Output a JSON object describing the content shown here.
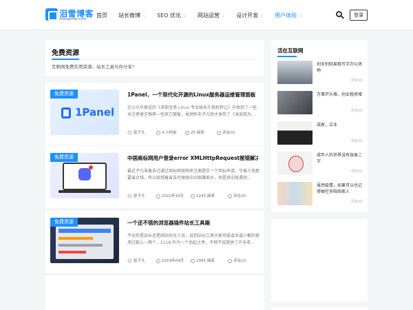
{
  "header": {
    "logo_text": "泪雪博客",
    "logo_sub": "zhangzifan.com",
    "nav": [
      {
        "label": "首页",
        "has_caret": false,
        "active": false
      },
      {
        "label": "站长微博",
        "has_caret": true,
        "active": false
      },
      {
        "label": "SEO 优化",
        "has_caret": true,
        "active": false
      },
      {
        "label": "网站运营",
        "has_caret": true,
        "active": false
      },
      {
        "label": "设计开发",
        "has_caret": true,
        "active": false
      },
      {
        "label": "用户体验",
        "has_caret": true,
        "active": true
      }
    ],
    "search_icon": "search-icon",
    "login_label": "登录"
  },
  "hero": {
    "title": "免费资源",
    "desc": "互联网免费实用资源，站长工具与你分享！"
  },
  "posts": [
    {
      "badge": "免费资源",
      "title": "1Panel，一个现代化开源的Linux服务器运维管理面板",
      "excerpt": "在公众号推送的《求购宝塔 Linux 专业版永久授权转让》中收到了一些关注者留言推荐一些其它面板，虽然昨天子凡我才发布了《浅谈我为...",
      "author": "张子凡",
      "time": "4 小时前",
      "views": "25 阅读",
      "comments": "评论(0)",
      "thumb_text": "1Panel"
    },
    {
      "badge": "免费资源",
      "title": "中国商标网用户登录error XMLHttpRequest报错解决...",
      "excerpt": "最近子凡准备自己通过商标网官网来注册提交一下商标申请，毕竟人壳那要省点钱，所以就想着省去代理商中间商赚差价，但是其中就遇到...",
      "author": "张子凡",
      "time": "2022年10月",
      "views": "1243 阅读",
      "comments": "评论(0)"
    },
    {
      "badge": "免费资源",
      "title": "一个还不错的浏览器插件站长工具箱",
      "excerpt": "不论你是站长还是网站优化人员，说到站长工具大家可能或多或少都的使用过那么一两个，5118 作为一个后起之秀，不得不说提供了许多非...",
      "author": "张子凡",
      "time": "2019年04月",
      "views": "2395 阅读",
      "comments": "评论(2)"
    }
  ],
  "sidebar": {
    "title": "活在互联网",
    "items": [
      {
        "title": "创业别轻易租写字办公场地",
        "comments": "评论(0)"
      },
      {
        "title": "万事开头难，创业租房难",
        "comments": "评论(0)"
      },
      {
        "title": "成家，立业",
        "comments": "评论(0)"
      },
      {
        "title": "成年人的世界没有容易二字",
        "comments": "评论(0)"
      },
      {
        "title": "虽然疫情，如果可以也记得抽空多陪陪家人",
        "comments": "评论(0)"
      }
    ]
  },
  "colors": {
    "accent": "#1e90ff",
    "background": "#f4f5f7"
  }
}
